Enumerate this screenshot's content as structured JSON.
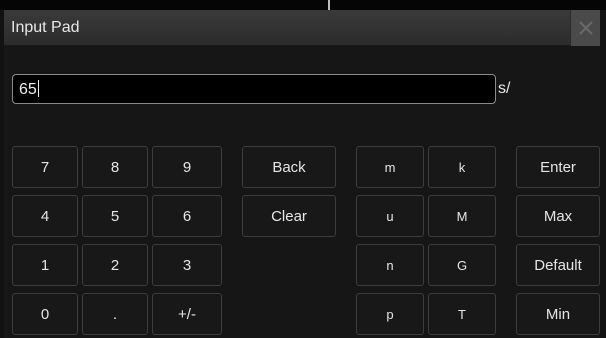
{
  "window": {
    "title": "Input Pad"
  },
  "input": {
    "value": "65",
    "unit": "s/"
  },
  "keypad": {
    "digits": [
      [
        "7",
        "8",
        "9"
      ],
      [
        "4",
        "5",
        "6"
      ],
      [
        "1",
        "2",
        "3"
      ],
      [
        "0",
        ".",
        "+/-"
      ]
    ],
    "edit": [
      "Back",
      "Clear"
    ],
    "prefixes": [
      [
        "m",
        "k"
      ],
      [
        "u",
        "M"
      ],
      [
        "n",
        "G"
      ],
      [
        "p",
        "T"
      ]
    ],
    "actions": [
      "Enter",
      "Max",
      "Default",
      "Min"
    ]
  },
  "icons": {
    "close": "close-icon"
  }
}
